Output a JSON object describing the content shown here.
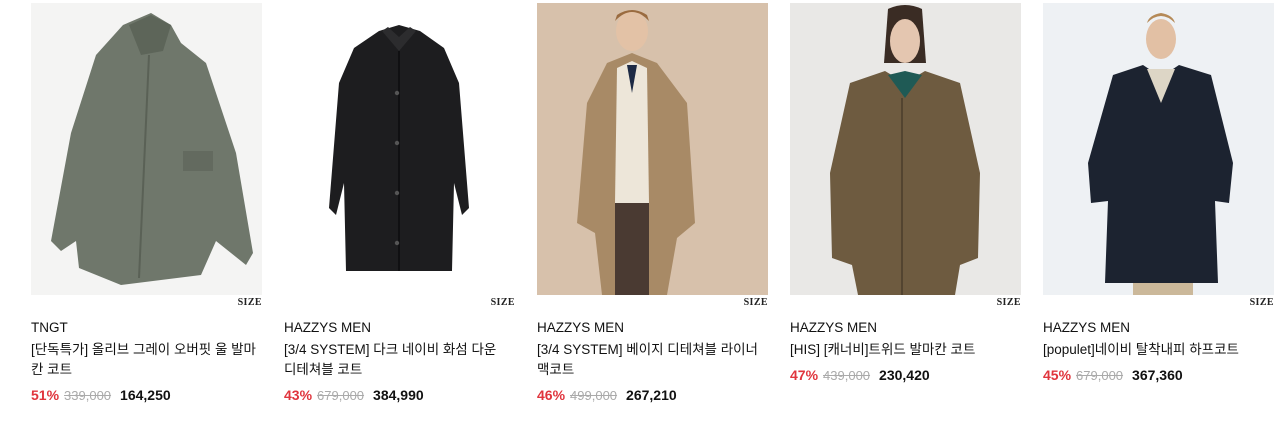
{
  "size_label": "SIZE",
  "colors": {
    "discount": "#e0353d",
    "original_price": "#aaaaaa"
  },
  "products": [
    {
      "image": "olive-gray-overcoat-flatlay",
      "brand": "TNGT",
      "name": "[단독특가] 올리브 그레이 오버핏 울 발마칸 코트",
      "discount": "51%",
      "original_price": "339,000",
      "price": "164,250"
    },
    {
      "image": "dark-navy-down-detachable-coat",
      "brand": "HAZZYS MEN",
      "name": "[3/4 SYSTEM] 다크 네이비 화섬 다운 디테쳐블 코트",
      "discount": "43%",
      "original_price": "679,000",
      "price": "384,990"
    },
    {
      "image": "beige-detachable-liner-mac-coat-model",
      "brand": "HAZZYS MEN",
      "name": "[3/4 SYSTEM] 베이지 디테쳐블 라이너 맥코트",
      "discount": "46%",
      "original_price": "499,000",
      "price": "267,210"
    },
    {
      "image": "tweed-balmacaan-coat-model",
      "brand": "HAZZYS MEN",
      "name": "[HIS] [캐너비]트위드 발마칸 코트",
      "discount": "47%",
      "original_price": "439,000",
      "price": "230,420"
    },
    {
      "image": "navy-detachable-half-coat-model",
      "brand": "HAZZYS MEN",
      "name": "[populet]네이비 탈착내피 하프코트",
      "discount": "45%",
      "original_price": "679,000",
      "price": "367,360"
    }
  ]
}
